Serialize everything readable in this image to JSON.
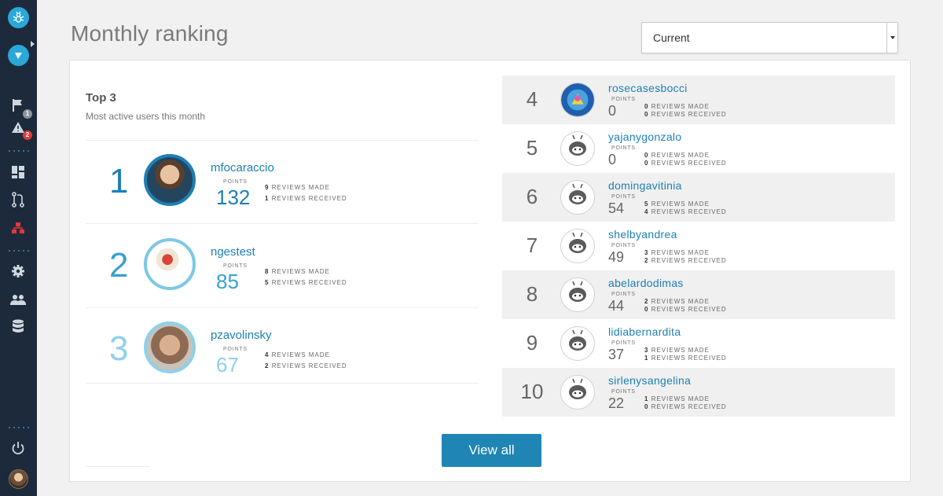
{
  "header": {
    "title": "Monthly ranking"
  },
  "period_select": {
    "value": "Current"
  },
  "sidebar": {
    "badges": {
      "flag": "1",
      "alert": "2"
    }
  },
  "top3": {
    "title": "Top 3",
    "subtitle": "Most active users this month",
    "points_label": "POINTS",
    "made_label": "REVIEWS MADE",
    "received_label": "REVIEWS RECEIVED",
    "users": [
      {
        "rank": "1",
        "name": "mfocaraccio",
        "points": "132",
        "made": "9",
        "received": "1"
      },
      {
        "rank": "2",
        "name": "ngestest",
        "points": "85",
        "made": "8",
        "received": "5"
      },
      {
        "rank": "3",
        "name": "pzavolinsky",
        "points": "67",
        "made": "4",
        "received": "2"
      }
    ]
  },
  "ranking": {
    "points_label": "POINTS",
    "made_label": "REVIEWS MADE",
    "received_label": "REVIEWS RECEIVED",
    "users": [
      {
        "rank": "4",
        "name": "rosecasesbocci",
        "points": "0",
        "made": "0",
        "received": "0"
      },
      {
        "rank": "5",
        "name": "yajanygonzalo",
        "points": "0",
        "made": "0",
        "received": "0"
      },
      {
        "rank": "6",
        "name": "domingavitinia",
        "points": "54",
        "made": "5",
        "received": "4"
      },
      {
        "rank": "7",
        "name": "shelbyandrea",
        "points": "49",
        "made": "3",
        "received": "2"
      },
      {
        "rank": "8",
        "name": "abelardodimas",
        "points": "44",
        "made": "2",
        "received": "0"
      },
      {
        "rank": "9",
        "name": "lidiabernardita",
        "points": "37",
        "made": "3",
        "received": "1"
      },
      {
        "rank": "10",
        "name": "sirlenysangelina",
        "points": "22",
        "made": "1",
        "received": "0"
      }
    ]
  },
  "view_all_label": "View all"
}
